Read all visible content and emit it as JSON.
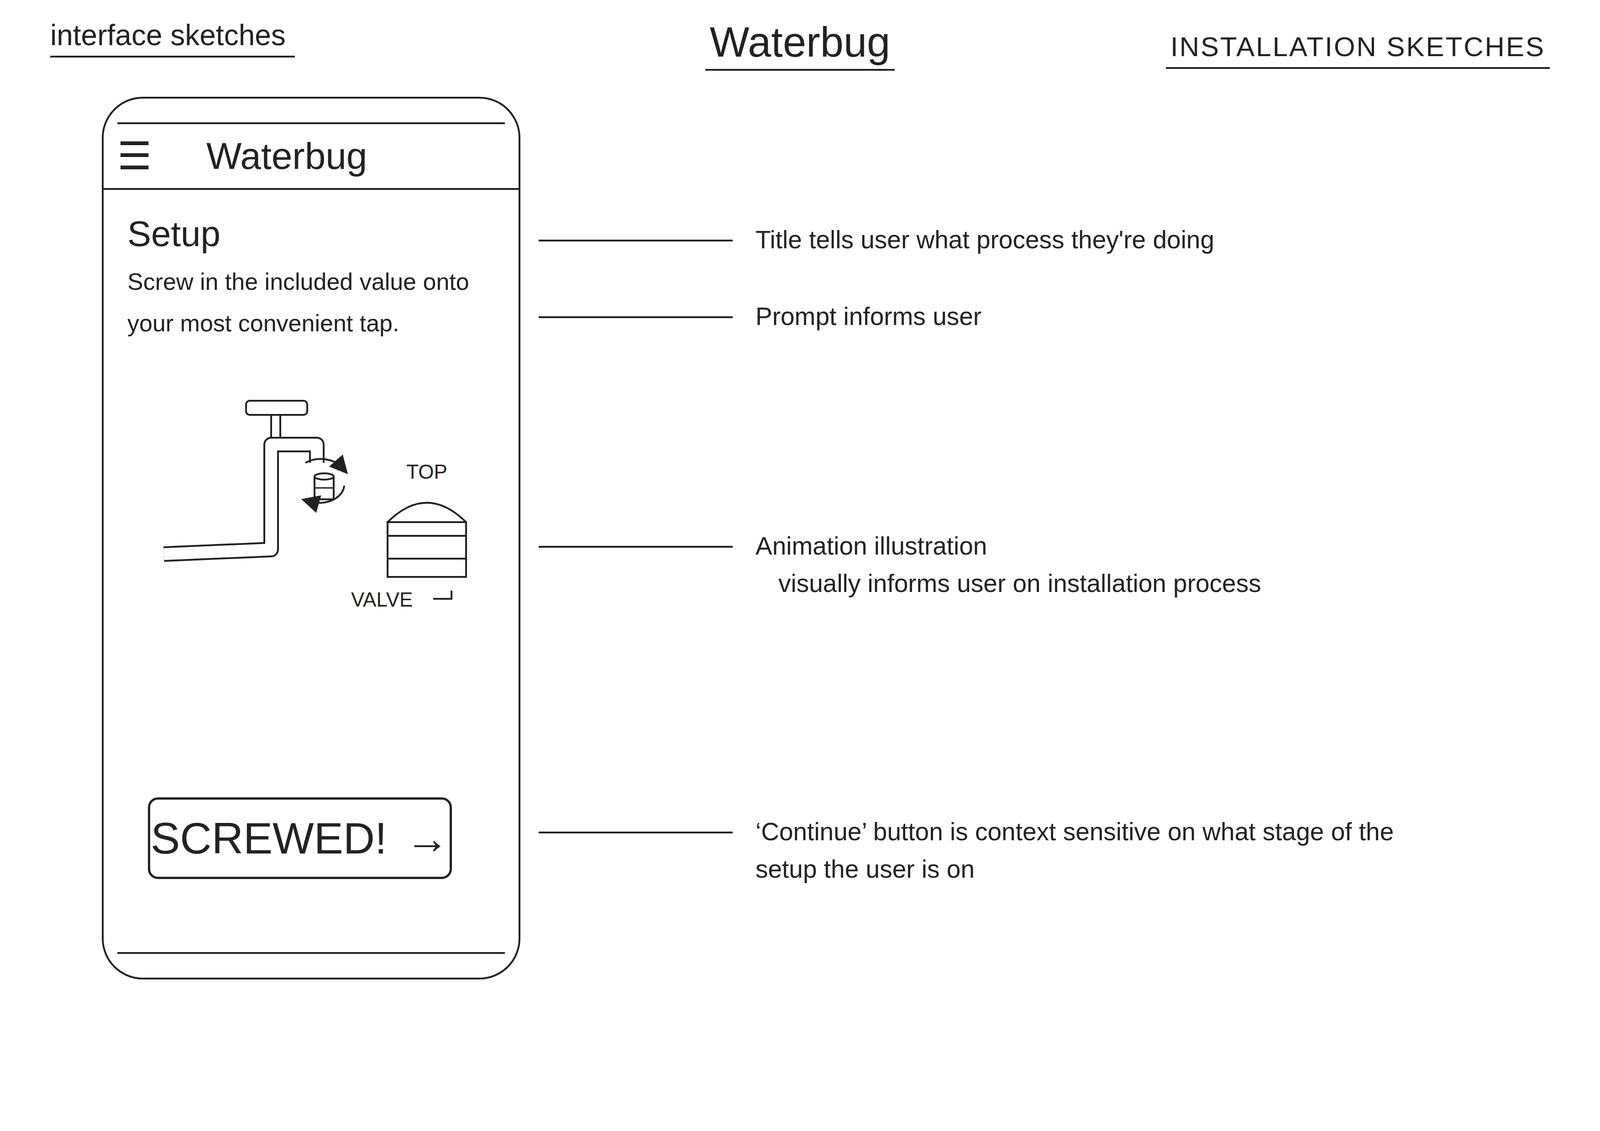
{
  "sheet": {
    "left_heading": "interface sketches",
    "title": "Waterbug",
    "right_heading": "INSTALLATION SKETCHES"
  },
  "phone": {
    "menu_icon": "☰",
    "app_title": "Waterbug",
    "screen_title": "Setup",
    "prompt": "Screw in the included value onto your most convenient tap.",
    "illustration_labels": {
      "top": "TOP",
      "valve": "VALVE"
    },
    "button": {
      "label": "SCREWED!",
      "icon": "→"
    }
  },
  "annotations": [
    {
      "lines": [
        "Title tells user what process they're doing"
      ]
    },
    {
      "lines": [
        "Prompt informs user"
      ]
    },
    {
      "lines": [
        "Animation illustration",
        "visually informs user on installation process"
      ]
    },
    {
      "lines": [
        "‘Continue’ button is context sensitive on what stage of the setup the user is on"
      ]
    }
  ]
}
